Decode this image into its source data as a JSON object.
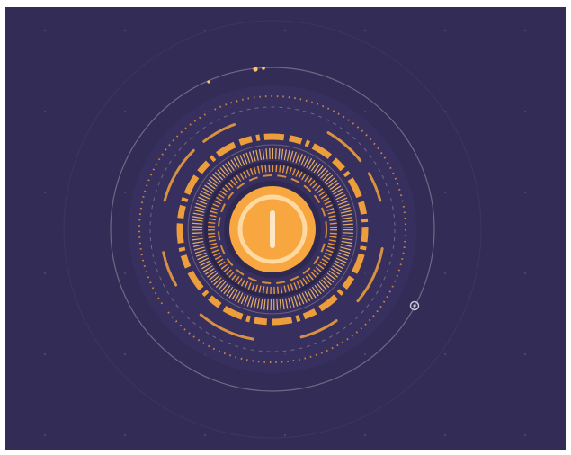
{
  "illustration": {
    "subject": "power-button-icon",
    "colors": {
      "background": "#332c57",
      "accent": "#f5a33a",
      "accent_light": "#ffc36a",
      "core": "#f7a640",
      "ring_line": "#8a8196",
      "dot_grid": "#4a4470"
    }
  }
}
